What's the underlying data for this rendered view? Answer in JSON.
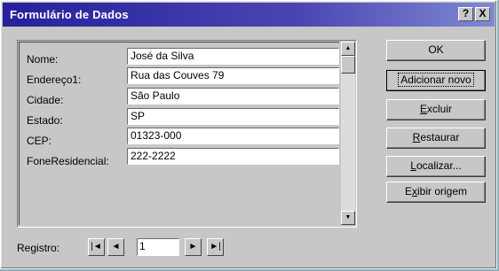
{
  "window": {
    "title": "Formulário de Dados",
    "help_glyph": "?",
    "close_glyph": "X"
  },
  "fields": [
    {
      "label": "Nome:",
      "value": "José da Silva"
    },
    {
      "label": "Endereço1:",
      "value": "Rua das Couves 79"
    },
    {
      "label": "Cidade:",
      "value": "São Paulo"
    },
    {
      "label": "Estado:",
      "value": "SP"
    },
    {
      "label": "CEP:",
      "value": "01323-000"
    },
    {
      "label": "FoneResidencial:",
      "value": "222-2222"
    }
  ],
  "buttons": {
    "ok": "OK",
    "add_new": "Adicionar novo",
    "delete_pre": "",
    "delete_key": "E",
    "delete_post": "xcluir",
    "restore_pre": "",
    "restore_key": "R",
    "restore_post": "estaurar",
    "find_pre": "",
    "find_key": "L",
    "find_post": "ocalizar...",
    "show_source_pre": "E",
    "show_source_key": "x",
    "show_source_post": "ibir origem"
  },
  "navigator": {
    "label_pre": "Re",
    "label_key": "g",
    "label_post": "istro:",
    "current_record": "1",
    "first_glyph": "|◄",
    "prev_glyph": "◄",
    "next_glyph": "►",
    "last_glyph": "►|"
  },
  "scrollbar": {
    "up_glyph": "▲",
    "down_glyph": "▼"
  }
}
